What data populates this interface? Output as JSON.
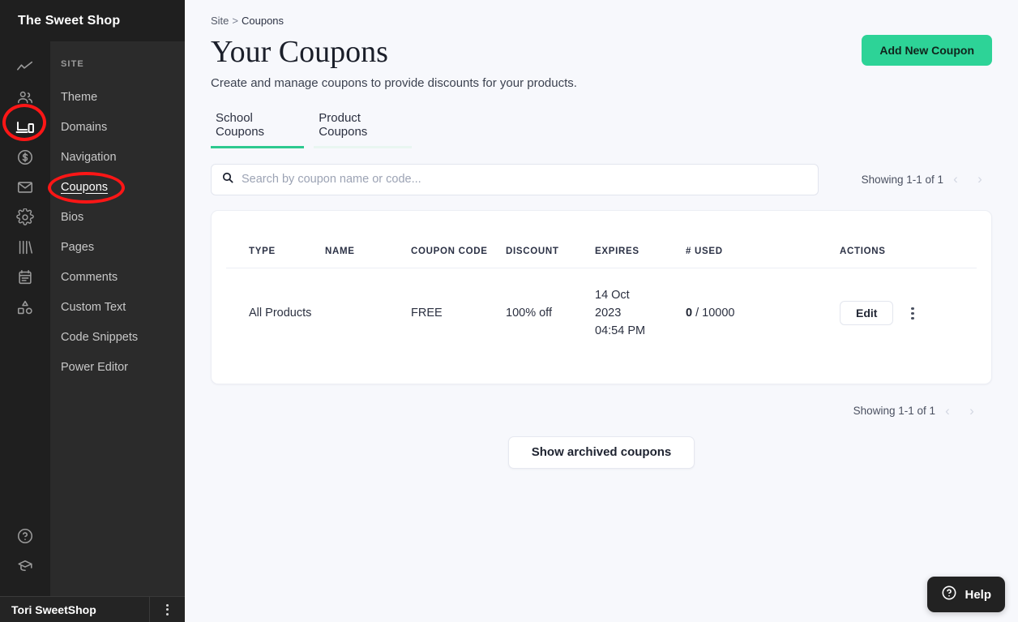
{
  "sidebar": {
    "brand": "The Sweet Shop",
    "rail_icons": [
      {
        "name": "analytics-icon",
        "active": false
      },
      {
        "name": "users-icon",
        "active": false
      },
      {
        "name": "devices-icon",
        "active": true
      },
      {
        "name": "dollar-circle-icon",
        "active": false
      },
      {
        "name": "mail-icon",
        "active": false
      },
      {
        "name": "gear-icon",
        "active": false
      },
      {
        "name": "books-icon",
        "active": false
      },
      {
        "name": "clipboard-icon",
        "active": false
      },
      {
        "name": "shapes-icon",
        "active": false
      }
    ],
    "rail_bottom_icons": [
      {
        "name": "help-circle-icon"
      },
      {
        "name": "graduation-cap-icon"
      }
    ],
    "section_label": "SITE",
    "items": [
      {
        "label": "Theme",
        "active": false
      },
      {
        "label": "Domains",
        "active": false
      },
      {
        "label": "Navigation",
        "active": false
      },
      {
        "label": "Coupons",
        "active": true
      },
      {
        "label": "Bios",
        "active": false
      },
      {
        "label": "Pages",
        "active": false
      },
      {
        "label": "Comments",
        "active": false
      },
      {
        "label": "Custom Text",
        "active": false
      },
      {
        "label": "Code Snippets",
        "active": false
      },
      {
        "label": "Power Editor",
        "active": false
      }
    ],
    "user_name": "Tori SweetShop"
  },
  "breadcrumb": {
    "root": "Site",
    "separator": ">",
    "current": "Coupons"
  },
  "header": {
    "title": "Your Coupons",
    "subtitle": "Create and manage coupons to provide discounts for your products.",
    "add_button": "Add New Coupon"
  },
  "tabs": [
    {
      "label": "School Coupons",
      "active": true
    },
    {
      "label": "Product Coupons",
      "active": false
    }
  ],
  "search": {
    "value": "",
    "placeholder": "Search by coupon name or code..."
  },
  "pagination_top": {
    "text": "Showing 1-1 of 1",
    "prev": "‹",
    "next": "›"
  },
  "pagination_bottom": {
    "text": "Showing 1-1 of 1",
    "prev": "‹",
    "next": "›"
  },
  "table": {
    "columns": [
      "TYPE",
      "NAME",
      "COUPON CODE",
      "DISCOUNT",
      "EXPIRES",
      "# USED",
      "ACTIONS"
    ],
    "rows": [
      {
        "type": "All Products",
        "name": "",
        "coupon_code": "FREE",
        "discount": "100% off",
        "expires_date": "14 Oct",
        "expires_year": "2023",
        "expires_time": "04:54 PM",
        "used_count": "0",
        "used_separator": "/",
        "used_limit": "10000",
        "edit_label": "Edit"
      }
    ]
  },
  "archive_button": "Show archived coupons",
  "help_fab": "Help",
  "colors": {
    "accent_green": "#2dd397",
    "tab_underline": "#2dc98f",
    "sidebar_dark": "#1f1f1f",
    "sidebar_panel": "#2b2b2b",
    "page_bg": "#f7f8fc",
    "annotation_red": "#fd1616"
  }
}
